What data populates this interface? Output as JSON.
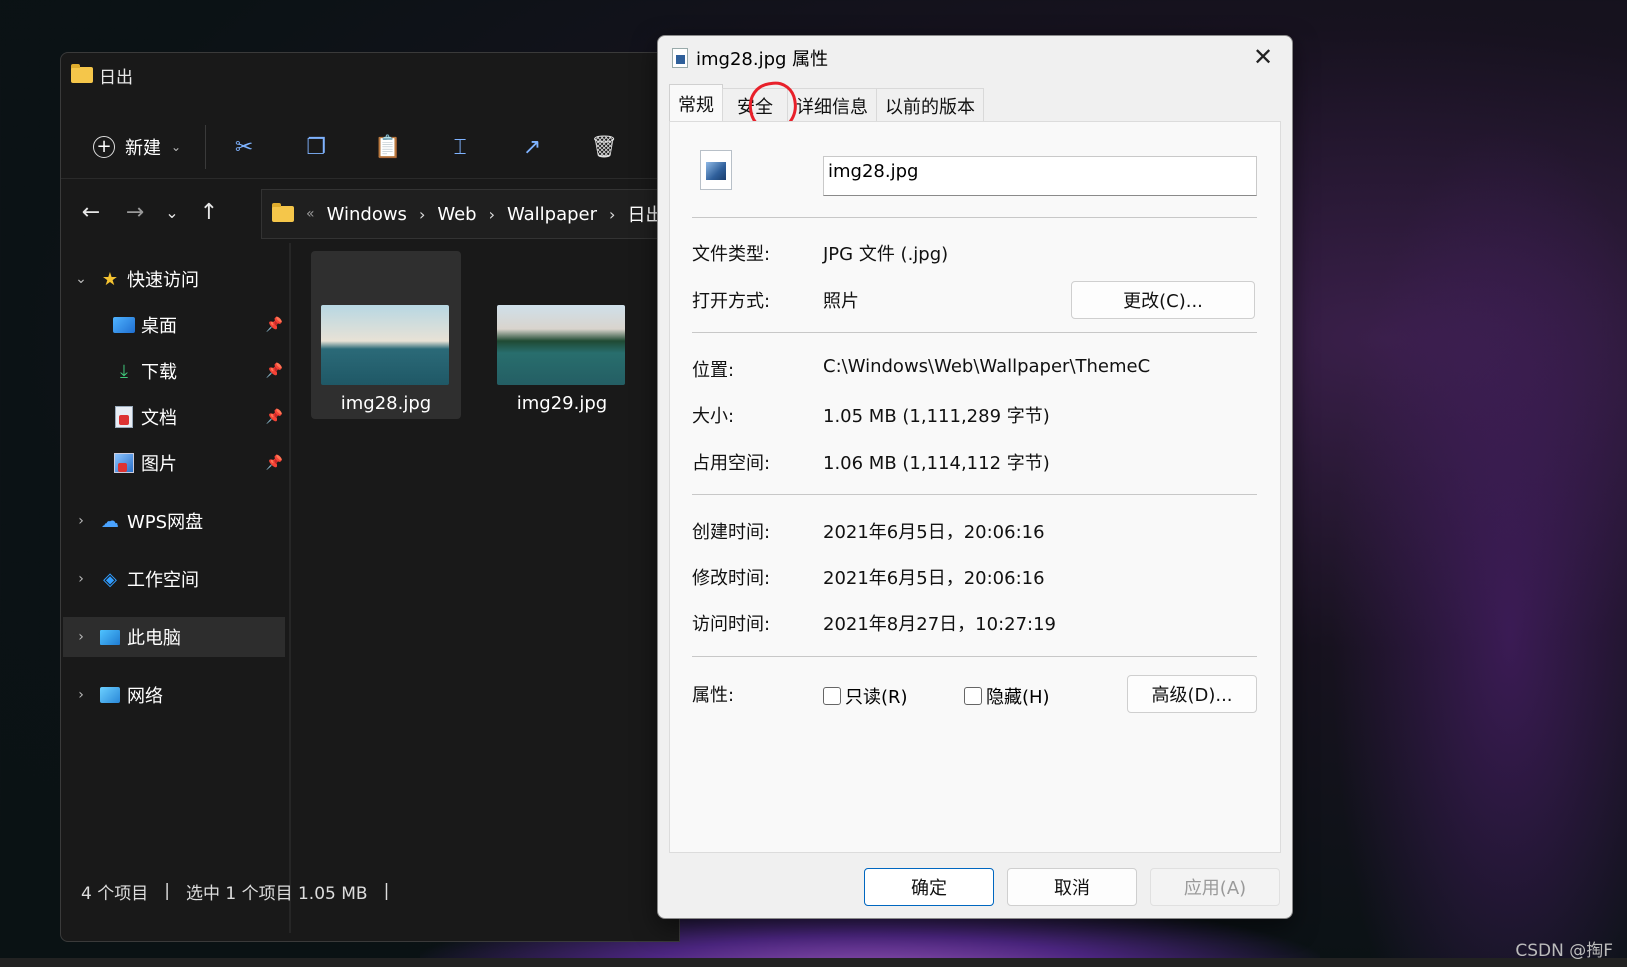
{
  "explorer": {
    "title": "日出",
    "toolbar": {
      "new_label": "新建"
    },
    "breadcrumb": [
      "Windows",
      "Web",
      "Wallpaper",
      "日出"
    ],
    "sidebar": {
      "quick_access": "快速访问",
      "items": [
        {
          "label": "桌面"
        },
        {
          "label": "下载"
        },
        {
          "label": "文档"
        },
        {
          "label": "图片"
        }
      ],
      "wps": "WPS网盘",
      "workspace": "工作空间",
      "this_pc": "此电脑",
      "network": "网络"
    },
    "files": [
      {
        "name": "img28.jpg",
        "selected": true
      },
      {
        "name": "img29.jpg",
        "selected": false
      }
    ],
    "status": {
      "count": "4 个项目",
      "selection": "选中 1 个项目  1.05 MB"
    }
  },
  "dialog": {
    "title": "img28.jpg 属性",
    "tabs": [
      "常规",
      "安全",
      "详细信息",
      "以前的版本"
    ],
    "filename": "img28.jpg",
    "file_type_label": "文件类型:",
    "file_type_value": "JPG 文件 (.jpg)",
    "open_with_label": "打开方式:",
    "open_with_value": "照片",
    "change_button": "更改(C)...",
    "location_label": "位置:",
    "location_value": "C:\\Windows\\Web\\Wallpaper\\ThemeC",
    "size_label": "大小:",
    "size_value": "1.05 MB (1,111,289 字节)",
    "size_on_disk_label": "占用空间:",
    "size_on_disk_value": "1.06 MB (1,114,112 字节)",
    "created_label": "创建时间:",
    "created_value": "2021年6月5日，20:06:16",
    "modified_label": "修改时间:",
    "modified_value": "2021年6月5日，20:06:16",
    "accessed_label": "访问时间:",
    "accessed_value": "2021年8月27日，10:27:19",
    "attributes_label": "属性:",
    "readonly_label": "只读(R)",
    "hidden_label": "隐藏(H)",
    "advanced_button": "高级(D)...",
    "ok_button": "确定",
    "cancel_button": "取消",
    "apply_button": "应用(A)"
  },
  "watermark": "CSDN @掏F"
}
